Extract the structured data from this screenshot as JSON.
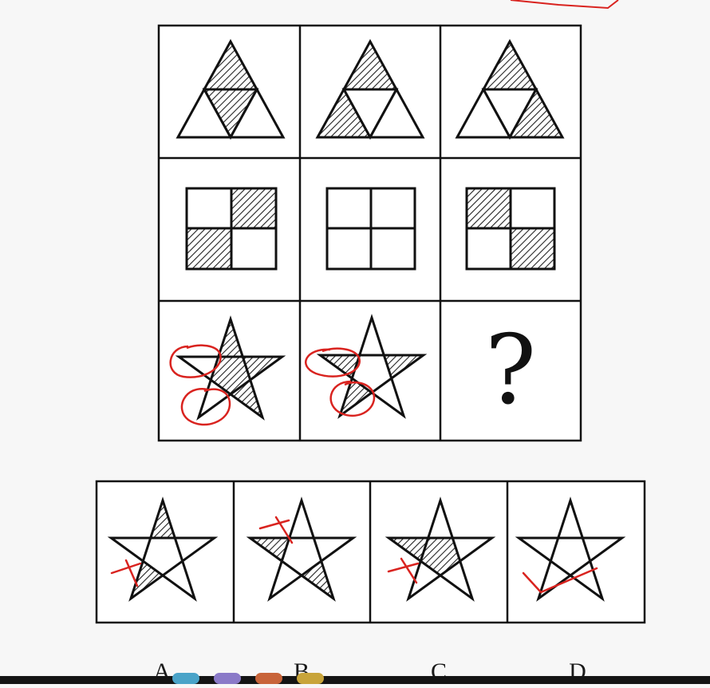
{
  "puzzle": {
    "question_mark": "?"
  },
  "options": [
    {
      "letter": "A"
    },
    {
      "letter": "B"
    },
    {
      "letter": "C"
    },
    {
      "letter": "D"
    }
  ],
  "colors": {
    "ink": "#111111",
    "hatch": "#222222",
    "annotation_red": "#d9231f",
    "taskbar": "#141414"
  }
}
